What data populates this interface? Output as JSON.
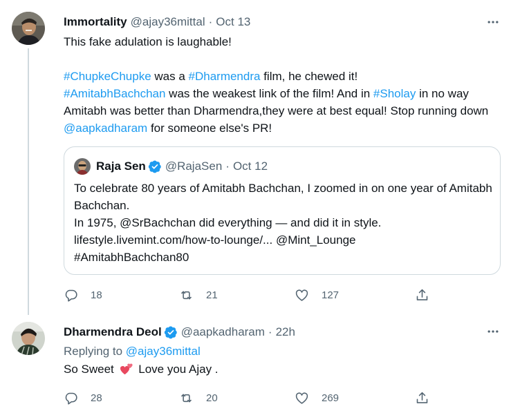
{
  "tweets": [
    {
      "author": {
        "name": "Immortality",
        "handle": "@ajay36mittal"
      },
      "separator": "·",
      "time": "Oct 13",
      "text": {
        "line1": "This fake adulation is laughable!",
        "p2": [
          {
            "t": "#ChupkeChupke",
            "link": true
          },
          {
            "t": " was a ",
            "link": false
          },
          {
            "t": "#Dharmendra",
            "link": true
          },
          {
            "t": " film, he chewed it!",
            "link": false
          }
        ],
        "p3": [
          {
            "t": "#AmitabhBachchan",
            "link": true
          },
          {
            "t": " was the weakest link of the film! And in ",
            "link": false
          },
          {
            "t": "#Sholay",
            "link": true
          },
          {
            "t": " in no way Amitabh was better than Dharmendra,they were at best equal! Stop running down ",
            "link": false
          },
          {
            "t": "@aapkadharam",
            "link": true
          },
          {
            "t": " for someone else's PR!",
            "link": false
          }
        ]
      },
      "quote": {
        "author": {
          "name": "Raja Sen",
          "handle": "@RajaSen"
        },
        "separator": "·",
        "time": "Oct 12",
        "lines": [
          "To celebrate 80 years of Amitabh Bachchan, I zoomed in on one year of Amitabh Bachchan.",
          "In 1975, @SrBachchan did everything — and did it in style.",
          "lifestyle.livemint.com/how-to-lounge/... @Mint_Lounge",
          "#AmitabhBachchan80"
        ]
      },
      "stats": {
        "replies": "18",
        "retweets": "21",
        "likes": "127"
      }
    },
    {
      "author": {
        "name": "Dharmendra Deol",
        "handle": "@aapkadharam"
      },
      "separator": "·",
      "time": "22h",
      "replying_to_label": "Replying to",
      "replying_to_handle": "@ajay36mittal",
      "text_before": "So Sweet",
      "text_after": "Love you Ajay .",
      "stats": {
        "replies": "28",
        "retweets": "20",
        "likes": "269"
      }
    }
  ],
  "icons": {
    "more": "more-icon",
    "reply": "reply-icon",
    "retweet": "retweet-icon",
    "like": "heart-icon",
    "share": "share-icon",
    "verified": "verified-badge-icon",
    "emoji": "two-hearts-emoji"
  },
  "colors": {
    "link": "#1d9bf0",
    "secondary": "#536471",
    "text": "#0f1419",
    "border": "#cfd9de"
  }
}
